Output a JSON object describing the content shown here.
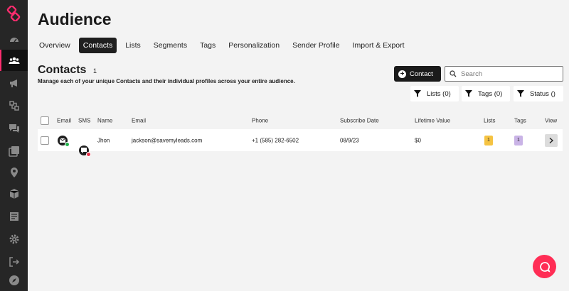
{
  "sidebar": {
    "items": [
      {
        "name": "dashboard"
      },
      {
        "name": "audience"
      },
      {
        "name": "campaigns"
      },
      {
        "name": "automations"
      },
      {
        "name": "conversations"
      },
      {
        "name": "content"
      },
      {
        "name": "locations"
      },
      {
        "name": "products"
      },
      {
        "name": "reports"
      },
      {
        "name": "settings"
      },
      {
        "name": "logout"
      },
      {
        "name": "explore"
      }
    ]
  },
  "header": {
    "title": "Audience"
  },
  "tabs": [
    {
      "label": "Overview"
    },
    {
      "label": "Contacts"
    },
    {
      "label": "Lists"
    },
    {
      "label": "Segments"
    },
    {
      "label": "Tags"
    },
    {
      "label": "Personalization"
    },
    {
      "label": "Sender Profile"
    },
    {
      "label": "Import & Export"
    }
  ],
  "contacts": {
    "title": "Contacts",
    "count": "1",
    "description": "Manage each of your unique Contacts and their individual profiles across your entire audience.",
    "add_label": "Contact",
    "search_placeholder": "Search",
    "filters": {
      "lists": "Lists (0)",
      "tags": "Tags (0)",
      "status": "Status ()"
    }
  },
  "table": {
    "headers": {
      "email_channel": "Email",
      "sms_channel": "SMS",
      "name": "Name",
      "email": "Email",
      "phone": "Phone",
      "subscribe_date": "Subscribe Date",
      "lifetime_value": "Lifetime Value",
      "lists": "Lists",
      "tags": "Tags",
      "view": "View"
    },
    "rows": [
      {
        "name": "Jhon",
        "email": "jackson@savemyleads.com",
        "phone": "+1 (585) 282-6502",
        "subscribe_date": "08/9/23",
        "lifetime_value": "$0",
        "lists": "1",
        "tags": "1",
        "email_status_color": "#22b14c",
        "sms_status_color": "#e8324a"
      }
    ]
  },
  "colors": {
    "accent": "#ff2d6f",
    "lists_pill": "#f5c342",
    "tags_pill": "#c9b3e6"
  }
}
